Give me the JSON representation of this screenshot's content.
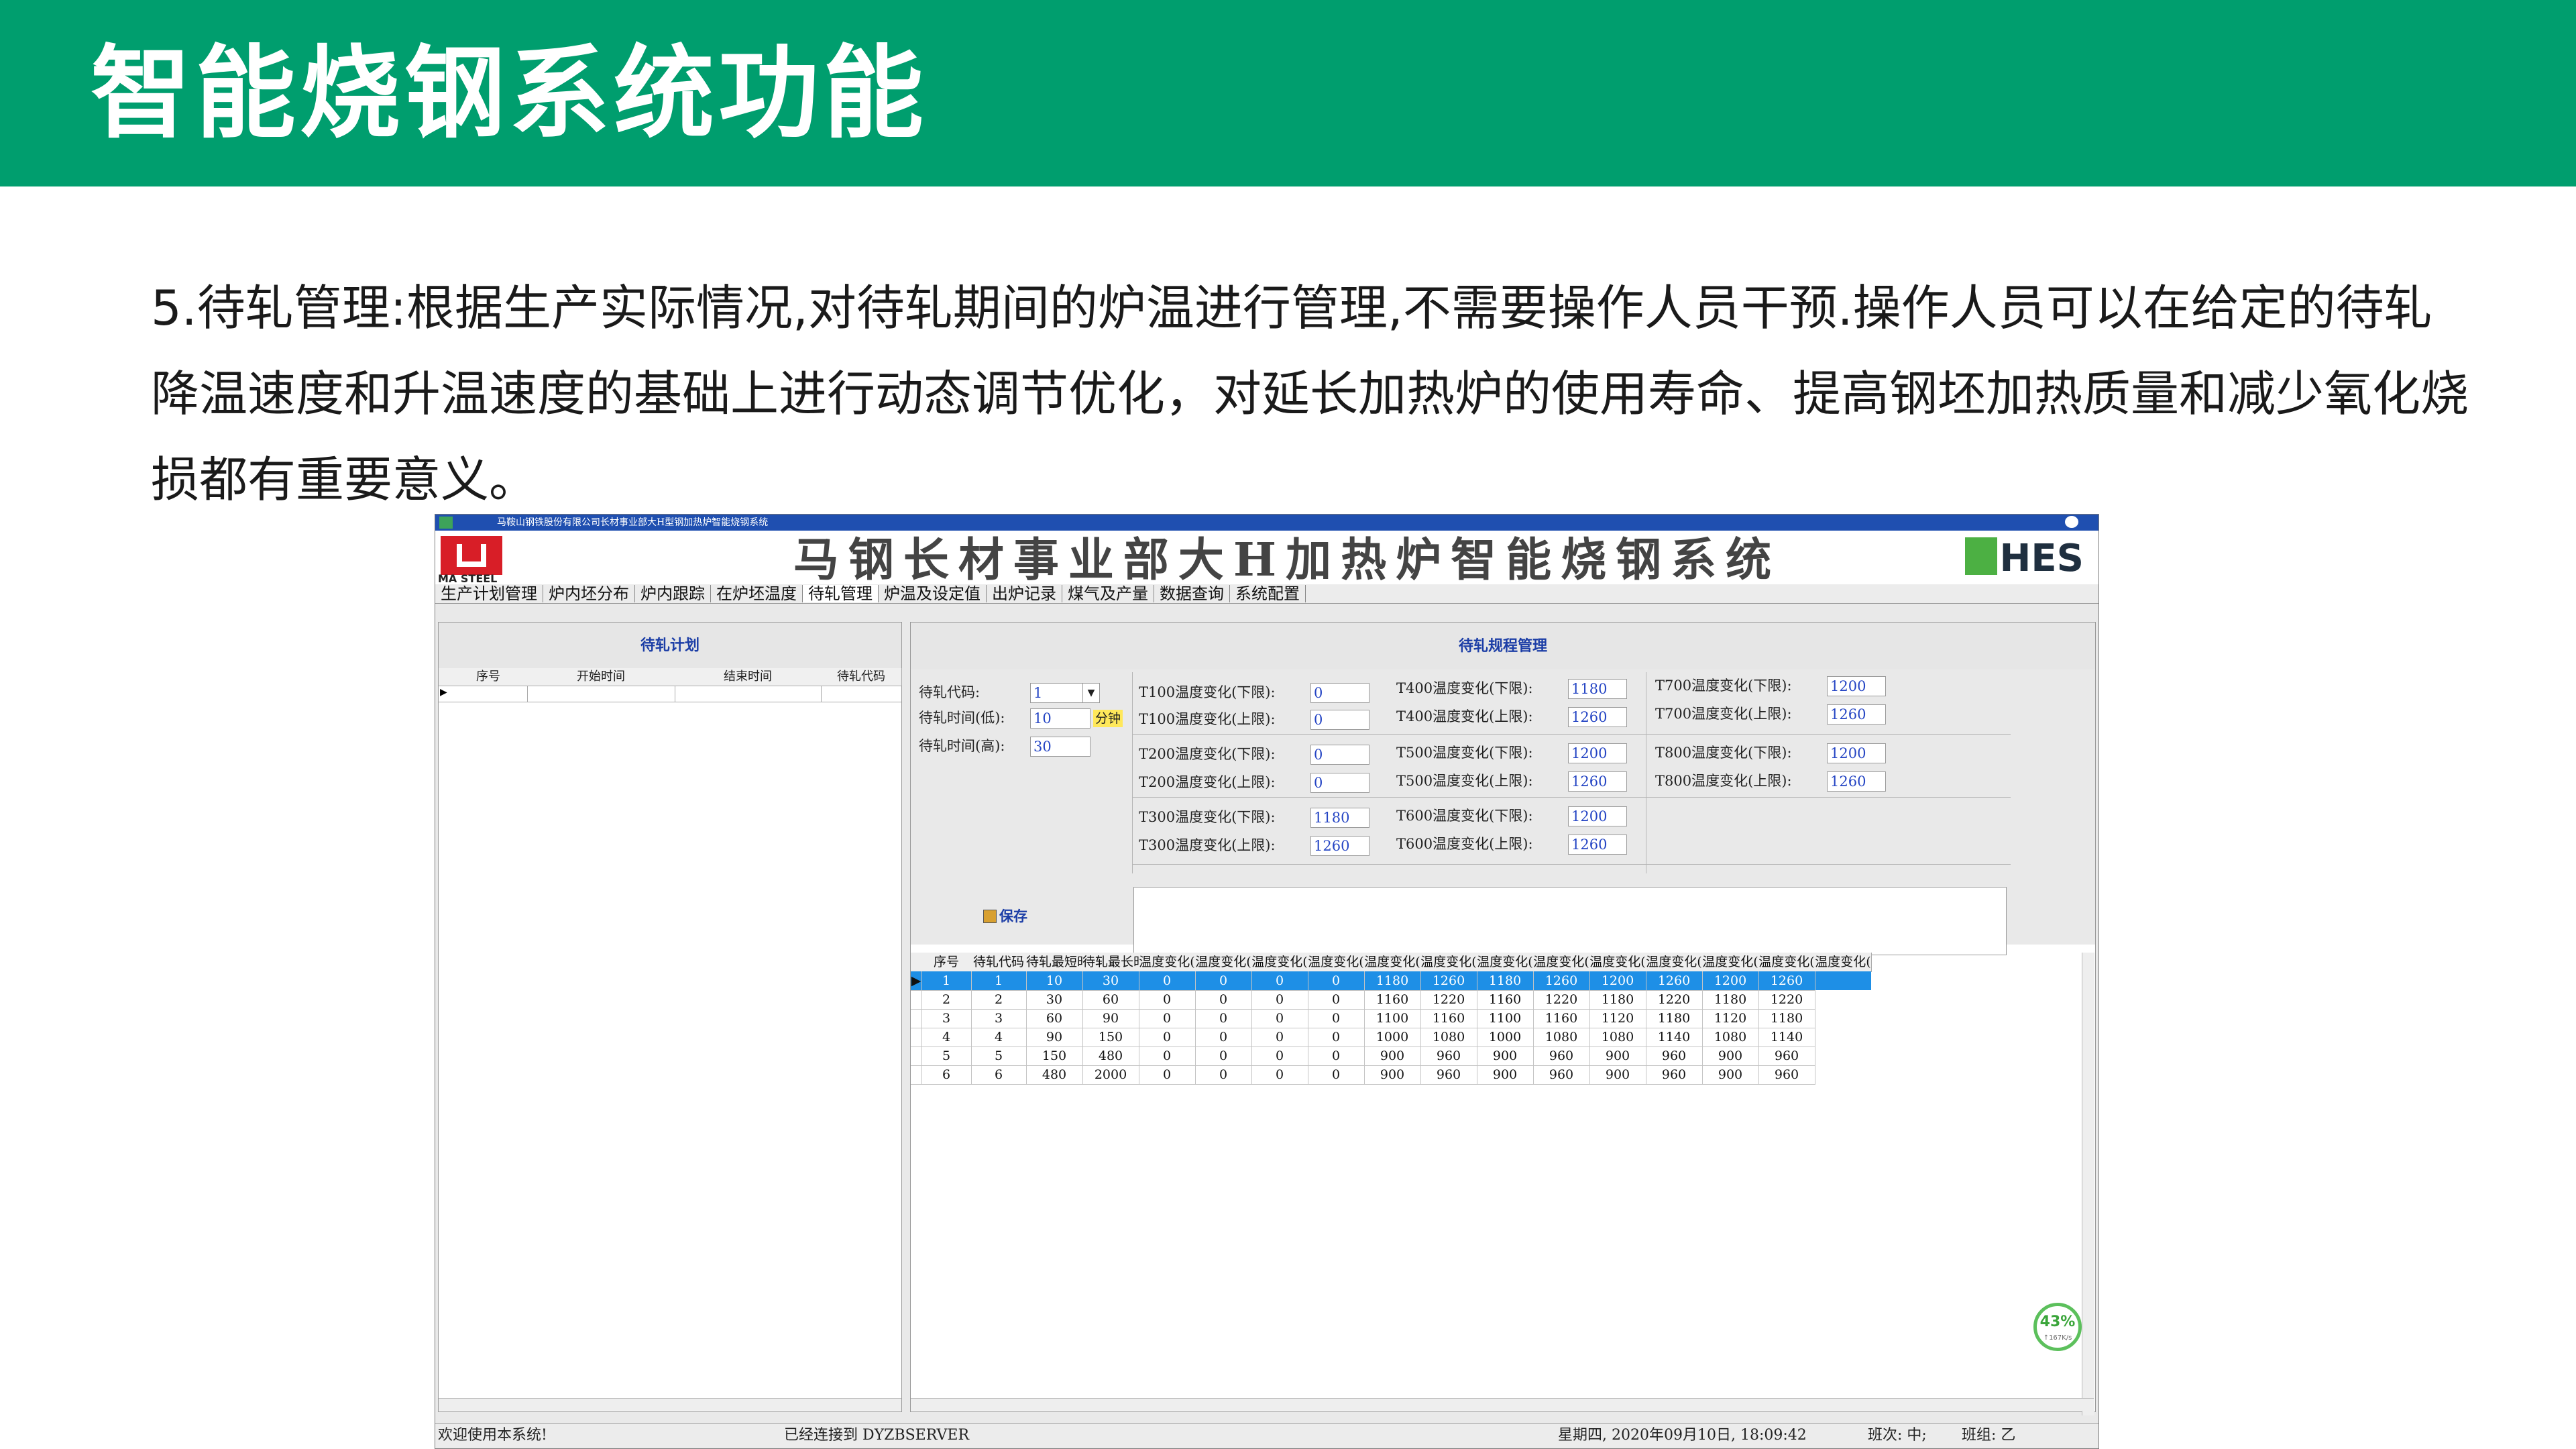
{
  "slide": {
    "title": "智能烧钢系统功能",
    "description": "5.待轧管理:根据生产实际情况,对待轧期间的炉温进行管理,不需要操作人员干预.操作人员可以在给定的待轧降温速度和升温速度的基础上进行动态调节优化，对延长加热炉的使用寿命、提高钢坯加热质量和减少氧化烧损都有重要意义。"
  },
  "colors": {
    "banner": "#009e6e",
    "selected_row": "#1e8fe6",
    "value_text": "#2545c4",
    "title_bar": "#1f4fb0"
  },
  "app": {
    "window_title": "马鞍山钢铁股份有限公司长材事业部大H型钢加热炉智能烧钢系统",
    "logo_text": "MA STEEL",
    "system_title": "马钢长材事业部大H加热炉智能烧钢系统",
    "brand": "HES",
    "menu": [
      "生产计划管理",
      "炉内坯分布",
      "炉内跟踪",
      "在炉坯温度",
      "待轧管理",
      "炉温及设定值",
      "出炉记录",
      "煤气及产量",
      "数据查询",
      "系统配置"
    ],
    "active_menu": "待轧管理",
    "plan_panel": {
      "title": "待轧计划",
      "columns": [
        "序号",
        "开始时间",
        "结束时间",
        "待轧代码"
      ]
    },
    "rules_panel": {
      "title": "待轧规程管理",
      "code_label": "待轧代码:",
      "code_value": "1",
      "time_low_label": "待轧时间(低):",
      "time_low_value": "10",
      "unit": "分钟",
      "time_high_label": "待轧时间(高):",
      "time_high_value": "30",
      "temps": [
        {
          "label": "T100温度变化(下限):",
          "value": "0"
        },
        {
          "label": "T100温度变化(上限):",
          "value": "0"
        },
        {
          "label": "T200温度变化(下限):",
          "value": "0"
        },
        {
          "label": "T200温度变化(上限):",
          "value": "0"
        },
        {
          "label": "T300温度变化(下限):",
          "value": "1180"
        },
        {
          "label": "T300温度变化(上限):",
          "value": "1260"
        },
        {
          "label": "T400温度变化(下限):",
          "value": "1180"
        },
        {
          "label": "T400温度变化(上限):",
          "value": "1260"
        },
        {
          "label": "T500温度变化(下限):",
          "value": "1200"
        },
        {
          "label": "T500温度变化(上限):",
          "value": "1260"
        },
        {
          "label": "T600温度变化(下限):",
          "value": "1200"
        },
        {
          "label": "T600温度变化(上限):",
          "value": "1260"
        },
        {
          "label": "T700温度变化(下限):",
          "value": "1200"
        },
        {
          "label": "T700温度变化(上限):",
          "value": "1260"
        },
        {
          "label": "T800温度变化(下限):",
          "value": "1200"
        },
        {
          "label": "T800温度变化(上限):",
          "value": "1260"
        }
      ],
      "save_label": "保存"
    },
    "grid": {
      "columns": [
        "序号",
        "待轧代码",
        "待轧最短时间",
        "待轧最长时间",
        "温度变化(",
        "温度变化(",
        "温度变化(",
        "温度变化(",
        "温度变化(",
        "温度变化(",
        "温度变化(",
        "温度变化(",
        "温度变化(",
        "温度变化(",
        "温度变化(",
        "温度变化(",
        "温度变化(",
        "温度变化("
      ],
      "rows": [
        [
          "1",
          "1",
          "10",
          "30",
          "0",
          "0",
          "0",
          "0",
          "1180",
          "1260",
          "1180",
          "1260",
          "1200",
          "1260",
          "1200",
          "1260"
        ],
        [
          "2",
          "2",
          "30",
          "60",
          "0",
          "0",
          "0",
          "0",
          "1160",
          "1220",
          "1160",
          "1220",
          "1180",
          "1220",
          "1180",
          "1220"
        ],
        [
          "3",
          "3",
          "60",
          "90",
          "0",
          "0",
          "0",
          "0",
          "1100",
          "1160",
          "1100",
          "1160",
          "1120",
          "1180",
          "1120",
          "1180"
        ],
        [
          "4",
          "4",
          "90",
          "150",
          "0",
          "0",
          "0",
          "0",
          "1000",
          "1080",
          "1000",
          "1080",
          "1080",
          "1140",
          "1080",
          "1140"
        ],
        [
          "5",
          "5",
          "150",
          "480",
          "0",
          "0",
          "0",
          "0",
          "900",
          "960",
          "900",
          "960",
          "900",
          "960",
          "900",
          "960"
        ],
        [
          "6",
          "6",
          "480",
          "2000",
          "0",
          "0",
          "0",
          "0",
          "900",
          "960",
          "900",
          "960",
          "900",
          "960",
          "900",
          "960"
        ]
      ],
      "selected_row": 0
    },
    "status": {
      "welcome": "欢迎使用本系统!",
      "connection": "已经连接到 DYZBSERVER",
      "datetime": "星期四, 2020年09月10日, 18:09:42",
      "shift": "班次: 中;",
      "team": "班组: 乙"
    },
    "cpu": {
      "percent": "43%",
      "speed": "↑167K/s"
    }
  }
}
